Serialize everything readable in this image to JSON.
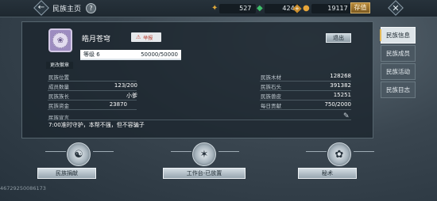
{
  "header": {
    "title": "民族主页",
    "help_symbol": "?",
    "currencies": [
      {
        "icon": "gold-feather-icon",
        "value": "527"
      },
      {
        "icon": "jade-icon",
        "value": "424"
      },
      {
        "icon": "coin-icon",
        "value": "19117"
      }
    ],
    "recharge_label": "存值"
  },
  "clan": {
    "name": "皓月苍穹",
    "change_emblem_label": "更改徽章",
    "report_label": "举报",
    "level_label": "等级 6",
    "xp_text": "50000/50000",
    "xp_fraction": 1.0,
    "exit_label": "退出",
    "stats_left": [
      {
        "label": "民族位置",
        "value": ""
      },
      {
        "label": "成员数量",
        "value": "123/200"
      },
      {
        "label": "民族族长",
        "value": "小爹"
      },
      {
        "label": "民族资金",
        "value": "23870"
      }
    ],
    "stats_right": [
      {
        "label": "民族木材",
        "value": "128268"
      },
      {
        "label": "民族石头",
        "value": "391382"
      },
      {
        "label": "民族兽皮",
        "value": "15251"
      },
      {
        "label": "每日贡献",
        "value": "750/2000"
      }
    ],
    "manifesto_label": "民族宣言",
    "manifesto_text": "7:00准时守护，本帮不强，但不容骗子"
  },
  "tabs": [
    {
      "label": "民族信息",
      "active": true
    },
    {
      "label": "民族成员",
      "active": false
    },
    {
      "label": "民族活动",
      "active": false
    },
    {
      "label": "民族目志",
      "active": false
    }
  ],
  "features": [
    {
      "label": "民族捐献",
      "icon": "donate-emblem-icon"
    },
    {
      "label": "工作台-已放置",
      "icon": "workbench-emblem-icon"
    },
    {
      "label": "秘术",
      "icon": "secret-art-emblem-icon"
    }
  ],
  "player_id": "46729250086173"
}
